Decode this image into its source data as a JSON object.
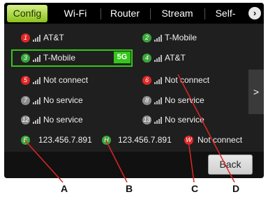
{
  "tabs": [
    {
      "label": "Config",
      "active": true
    },
    {
      "label": "Wi-Fi",
      "active": false
    },
    {
      "label": "Router",
      "active": false
    },
    {
      "label": "Stream",
      "active": false
    },
    {
      "label": "Self-",
      "active": false
    }
  ],
  "colors": {
    "accent": "#35c61a",
    "red_badge": "#e02626",
    "green_badge": "#3aa63a",
    "grey_badge": "#8d8d8d"
  },
  "slots": [
    {
      "num": "1",
      "color": "red",
      "label": "AT&T"
    },
    {
      "num": "2",
      "color": "green",
      "label": "T-Mobile"
    },
    {
      "num": "3",
      "color": "green",
      "label": "T-Mobile",
      "tag": "5G",
      "selected": true
    },
    {
      "num": "4",
      "color": "green",
      "label": "AT&T"
    },
    {
      "num": "5",
      "color": "red",
      "label": "Not connect"
    },
    {
      "num": "6",
      "color": "red",
      "label": "Not connect"
    },
    {
      "num": "7",
      "color": "grey",
      "label": "No service"
    },
    {
      "num": "8",
      "color": "grey",
      "label": "No service"
    },
    {
      "num": "12",
      "color": "grey",
      "label": "No service"
    },
    {
      "num": "13",
      "color": "grey",
      "label": "No service"
    }
  ],
  "interfaces": [
    {
      "letter": "E",
      "color": "green",
      "value": "123.456.7.891"
    },
    {
      "letter": "H",
      "color": "green",
      "value": "123.456.7.891"
    },
    {
      "letter": "W",
      "color": "red",
      "value": "Not connect"
    }
  ],
  "side_arrow": ">",
  "next_icon": "›",
  "back_label": "Back",
  "callouts": [
    "A",
    "B",
    "C",
    "D"
  ]
}
